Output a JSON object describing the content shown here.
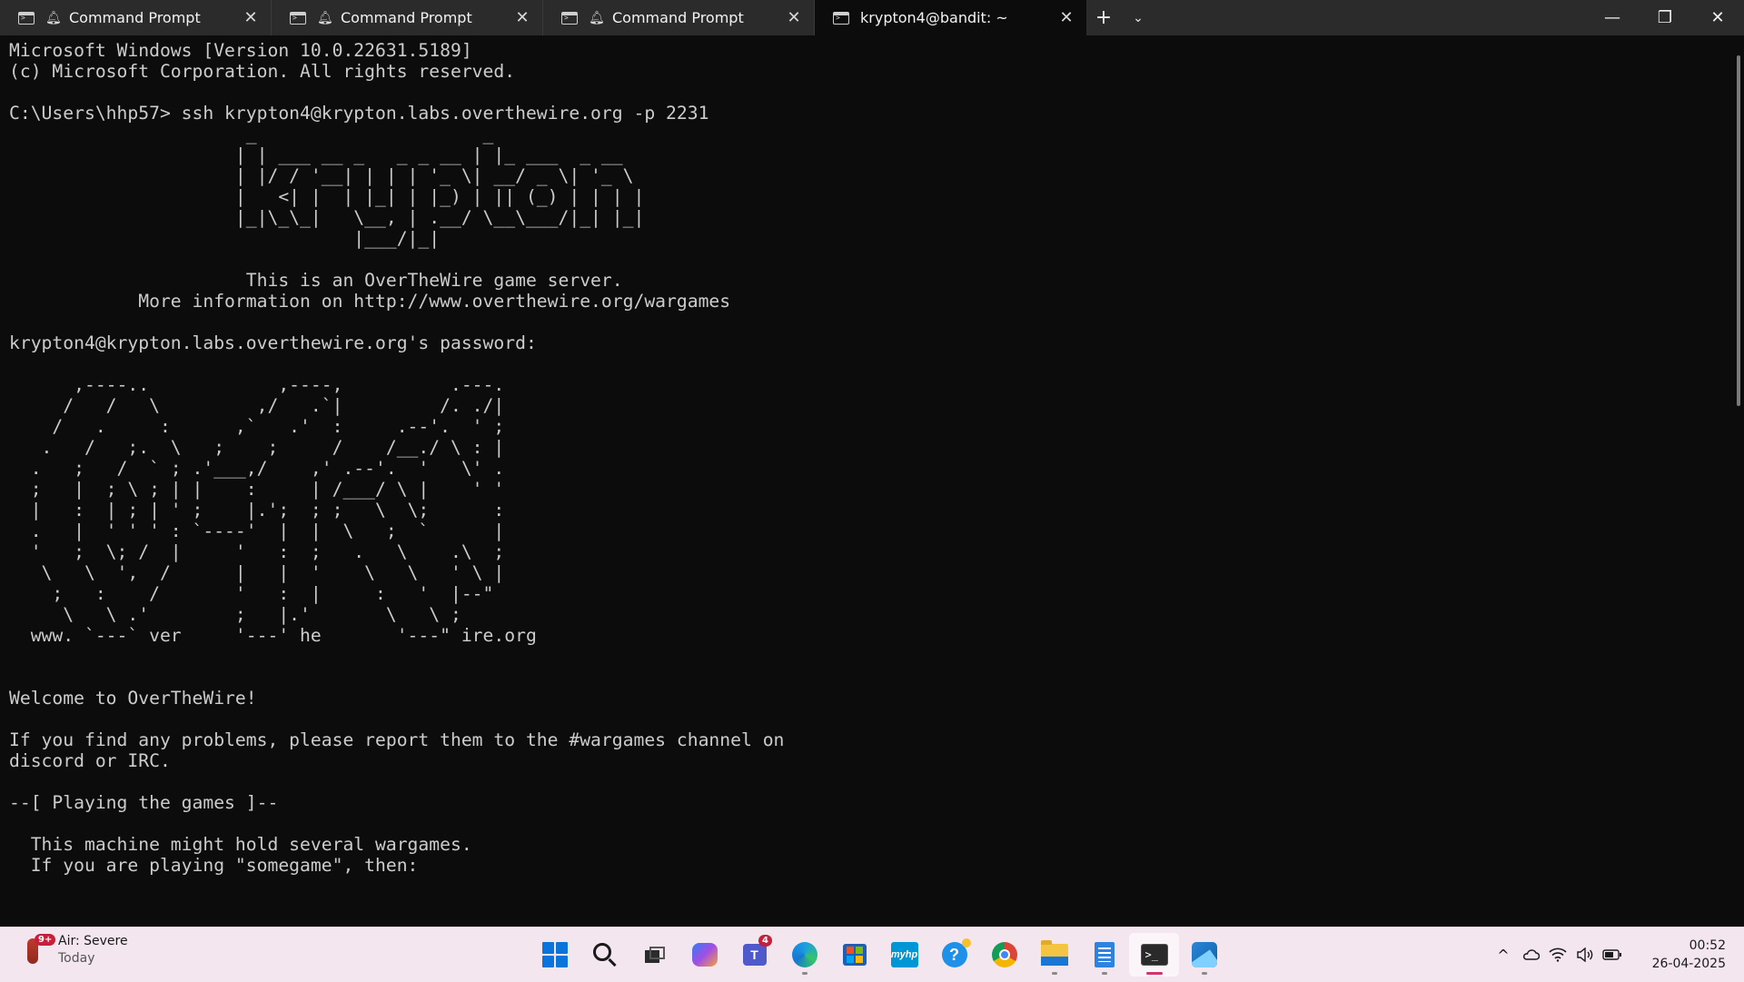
{
  "tabs": [
    {
      "label": "Command Prompt",
      "active": false
    },
    {
      "label": "Command Prompt",
      "active": false
    },
    {
      "label": "Command Prompt",
      "active": false
    },
    {
      "label": "krypton4@bandit: ~",
      "active": true
    }
  ],
  "tabbar": {
    "new_tab": "+",
    "dropdown": "⌄"
  },
  "window_controls": {
    "minimize": "—",
    "maximize": "❐",
    "close": "✕"
  },
  "terminal": {
    "lines": [
      "Microsoft Windows [Version 10.0.22631.5189]",
      "(c) Microsoft Corporation. All rights reserved.",
      "",
      "C:\\Users\\hhp57> ssh krypton4@krypton.labs.overthewire.org -p 2231",
      "                      _                     _",
      "                     | | ___ __ _   _ _ __ | |_ ___  _ __",
      "                     | |/ / '__| | | | '_ \\| __/ _ \\| '_ \\",
      "                     |   <| |  | |_| | |_) | || (_) | | | |",
      "                     |_|\\_\\_|   \\__, | .__/ \\__\\___/|_| |_|",
      "                                |___/|_|",
      "",
      "                      This is an OverTheWire game server.",
      "            More information on http://www.overthewire.org/wargames",
      "",
      "krypton4@krypton.labs.overthewire.org's password:",
      "",
      "      ,----..            ,----,          .---.",
      "     /   /   \\         ,/   .`|         /. ./|",
      "    /   .     :      ,`   .'  :     .--'.  ' ;",
      "   .   /   ;.  \\   ;    ;     /    /__./ \\ : |",
      "  .   ;   /  ` ; .'___,/    ,' .--'.  '   \\' .",
      "  ;   |  ; \\ ; | |    :     | /___/ \\ |    ' '",
      "  |   :  | ; | ' ;    |.';  ; ;   \\  \\;      :",
      "  .   |  ' ' ' : `----'  |  |  \\   ;  `      |",
      "  '   ;  \\; /  |     '   :  ;   .   \\    .\\  ;",
      "   \\   \\  ',  /      |   |  '    \\   \\   ' \\ |",
      "    ;   :    /       '   :  |     :   '  |--\"",
      "     \\   \\ .'        ;   |.'       \\   \\ ;",
      "  www. `---` ver     '---' he       '---\" ire.org",
      "",
      "",
      "Welcome to OverTheWire!",
      "",
      "If you find any problems, please report them to the #wargames channel on",
      "discord or IRC.",
      "",
      "--[ Playing the games ]--",
      "",
      "  This machine might hold several wargames.",
      "  If you are playing \"somegame\", then:"
    ]
  },
  "taskbar": {
    "weather": {
      "badge": "9+",
      "title": "Air: Severe",
      "subtitle": "Today"
    },
    "apps": [
      {
        "name": "start",
        "icon": "windows-icon"
      },
      {
        "name": "search",
        "icon": "search-icon"
      },
      {
        "name": "task-view",
        "icon": "task-view-icon"
      },
      {
        "name": "copilot",
        "icon": "copilot-icon"
      },
      {
        "name": "teams",
        "icon": "teams-icon",
        "badge": "4",
        "glyph": "T"
      },
      {
        "name": "edge",
        "icon": "edge-icon"
      },
      {
        "name": "microsoft-store",
        "icon": "store-icon"
      },
      {
        "name": "myhp",
        "icon": "myhp-icon",
        "glyph": "myhp"
      },
      {
        "name": "get-help",
        "icon": "help-icon",
        "glyph": "?"
      },
      {
        "name": "chrome",
        "icon": "chrome-icon"
      },
      {
        "name": "file-explorer",
        "icon": "folder-icon"
      },
      {
        "name": "notepad",
        "icon": "notepad-icon"
      },
      {
        "name": "terminal",
        "icon": "terminal-icon",
        "glyph": ">_"
      },
      {
        "name": "photos",
        "icon": "photos-icon"
      }
    ],
    "tray": {
      "chevron": "^",
      "clock_time": "00:52",
      "clock_date": "26-04-2025"
    }
  },
  "colors": {
    "terminal_bg": "#0c0c0c",
    "terminal_fg": "#cccccc",
    "tabbar_bg": "#2b2b2b",
    "taskbar_bg": "#f3e6ee",
    "active_indicator": "#d6336c"
  }
}
